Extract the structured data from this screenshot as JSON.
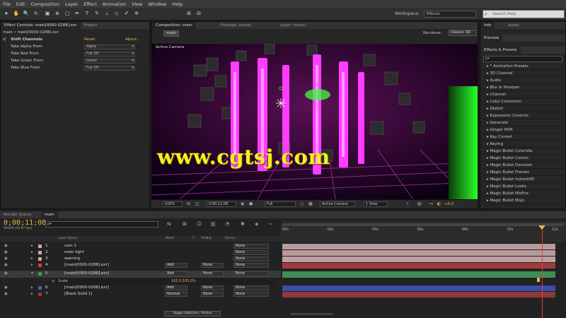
{
  "menu": [
    "File",
    "Edit",
    "Composition",
    "Layer",
    "Effect",
    "Animation",
    "View",
    "Window",
    "Help"
  ],
  "toolbar": {
    "workspace_label": "Workspace:",
    "workspace_value": "Effects",
    "search_placeholder": "Search Help"
  },
  "effect_controls": {
    "tabs": [
      "Effect Controls: main[0000-0288].exr",
      "Project"
    ],
    "breadcrumb": "main • main[0000-0288].exr",
    "effect_name": "Shift Channels",
    "reset": "Reset",
    "about": "About...",
    "rows": [
      {
        "label": "Take Alpha From",
        "value": "Alpha"
      },
      {
        "label": "Take Red From",
        "value": "Full Off"
      },
      {
        "label": "Take Green From",
        "value": "Green"
      },
      {
        "label": "Take Blue From",
        "value": "Full Off"
      }
    ]
  },
  "composition": {
    "tabs": [
      "Composition: main",
      "Footage: (none)",
      "Layer: (none)"
    ],
    "subtab": "main",
    "renderer_label": "Renderer:",
    "renderer_value": "Classic 3D",
    "camera_label": "Active Camera",
    "watermark": "www.cgtsj.com",
    "controls": {
      "zoom": "100%",
      "timecode": "0;00;11;08",
      "resolution": "Full",
      "camera": "Active Camera",
      "views": "1 View",
      "exposure": "+0.0"
    }
  },
  "right_panels": {
    "info_tab": "Info",
    "audio_tab": "Audio",
    "preview_tab": "Preview",
    "effects_tab": "Effects & Presets",
    "effects_search": "ρ▾",
    "effects": [
      "* Animation Presets",
      "3D Channel",
      "Audio",
      "Blur & Sharpen",
      "Channel",
      "Color Correction",
      "Distort",
      "Expression Controls",
      "Generate",
      "Ginger HDR",
      "Key Correct",
      "Keying",
      "Magic Bullet Colorista",
      "Magic Bullet Cosmo",
      "Magic Bullet Denoiser",
      "Magic Bullet Frames",
      "Magic Bullet InstantHD",
      "Magic Bullet Looks",
      "Magic Bullet MisFire",
      "Magic Bullet Mojo"
    ]
  },
  "timeline": {
    "tabs": [
      "Render Queue",
      "main"
    ],
    "timecode": "0;00;11;08",
    "frame_info": "00339 (29.97 fps)",
    "search": "ρ▾",
    "headers": {
      "name": "Layer Name",
      "mode": "Mode",
      "t": "T",
      "trkmat": "TrkMat",
      "parent": "Parent"
    },
    "layers": [
      {
        "num": "1",
        "name": "cam 1",
        "mode": "",
        "trk": "",
        "parent": "None",
        "color": "#c8a9a9",
        "bar": "#b89a9a"
      },
      {
        "num": "2",
        "name": "main light",
        "mode": "",
        "trk": "",
        "parent": "None",
        "color": "#d0aaaa",
        "bar": "#b89a9a"
      },
      {
        "num": "3",
        "name": "warning",
        "mode": "",
        "trk": "",
        "parent": "None",
        "color": "#c8a9a9",
        "bar": "#c0a0a0"
      },
      {
        "num": "4",
        "name": "[main[0000-0288].exr]",
        "mode": "Add",
        "trk": "None",
        "parent": "None",
        "color": "#cc3d3d",
        "bar": "#a33a3a"
      },
      {
        "num": "5",
        "name": "[main[0000-0288].exr]",
        "mode": "Add",
        "trk": "None",
        "parent": "None",
        "color": "#3b9b50",
        "bar": "#3f8f55"
      },
      {
        "num": "6",
        "name": "[main[0000-0288].exr]",
        "mode": "Add",
        "trk": "None",
        "parent": "None",
        "color": "#4a5cc4",
        "bar": "#3c4ca8"
      },
      {
        "num": "7",
        "name": "[Black Solid 1]",
        "mode": "Normal",
        "trk": "None",
        "parent": "None",
        "color": "#a33535",
        "bar": "#8e3a3a"
      }
    ],
    "scale_label": "Scale",
    "scale_value": "105.0,105.0%",
    "ruler": [
      "00s",
      "02s",
      "04s",
      "06s",
      "08s",
      "10s",
      "12s"
    ],
    "footer": "Toggle Switches / Modes"
  }
}
